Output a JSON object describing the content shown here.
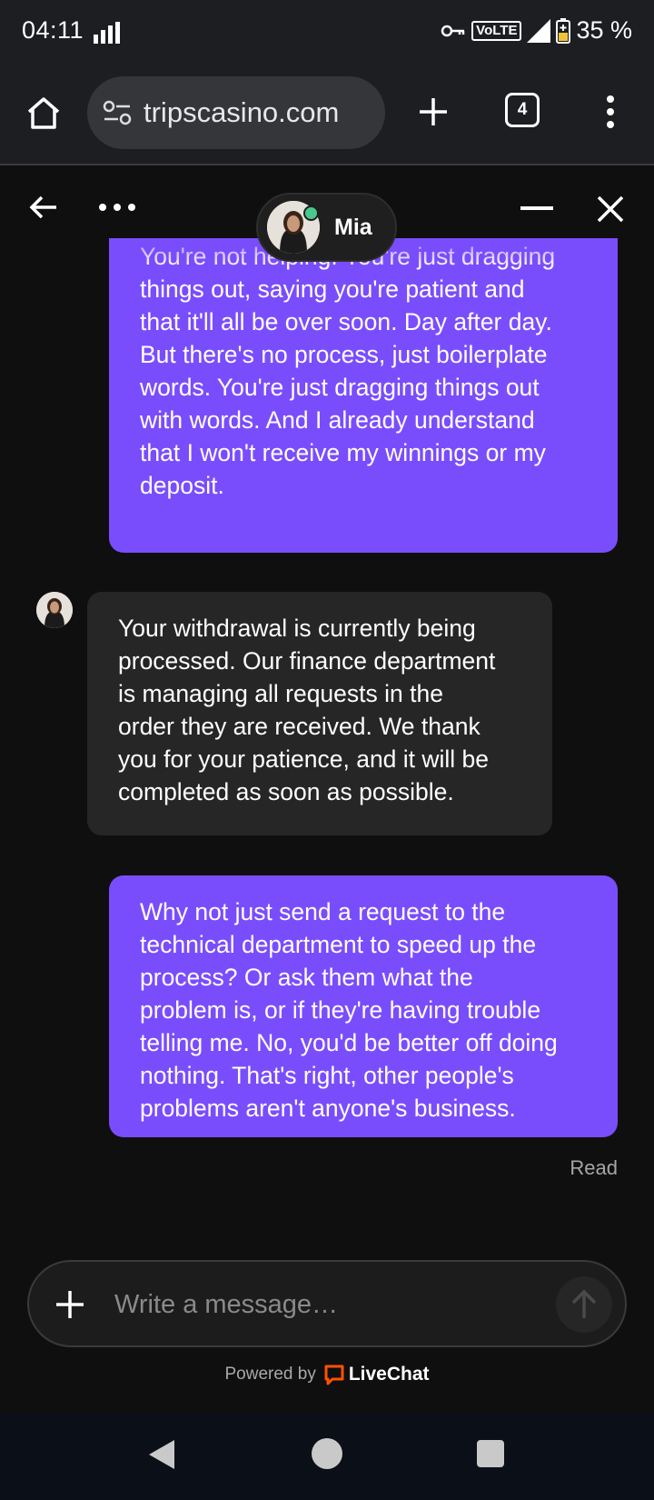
{
  "status_bar": {
    "time": "04:11",
    "network": "VoLTE",
    "battery": "35 %"
  },
  "browser": {
    "url": "tripscasino.com",
    "tab_count": "4"
  },
  "chat": {
    "agent_name": "Mia",
    "messages": [
      {
        "from": "user",
        "text": "You're not helping. You're just dragging\nthings out, saying you're patient and\nthat it'll all be over soon. Day after day.\nBut there's no process, just boilerplate\nwords. You're just dragging things out\nwith words. And I already understand\nthat I won't receive my winnings or my\ndeposit."
      },
      {
        "from": "agent",
        "text": "Your withdrawal is currently being\nprocessed. Our finance department\nis managing all requests in the\norder they are received. We thank\nyou for your patience, and it will be\ncompleted as soon as possible."
      },
      {
        "from": "user",
        "text": "Why not just send a request to the\ntechnical department to speed up the\nprocess? Or ask them what the\nproblem is, or if they're having trouble\ntelling me. No, you'd be better off doing\nnothing. That's right, other people's\nproblems aren't anyone's business."
      }
    ],
    "read_status": "Read",
    "composer_placeholder": "Write a message…",
    "powered_by": "Powered by",
    "brand": "LiveChat"
  },
  "colors": {
    "user_bubble": "#7a4dfc",
    "agent_bubble": "#262626",
    "online": "#48c78e",
    "livechat_orange": "#ff5100"
  }
}
